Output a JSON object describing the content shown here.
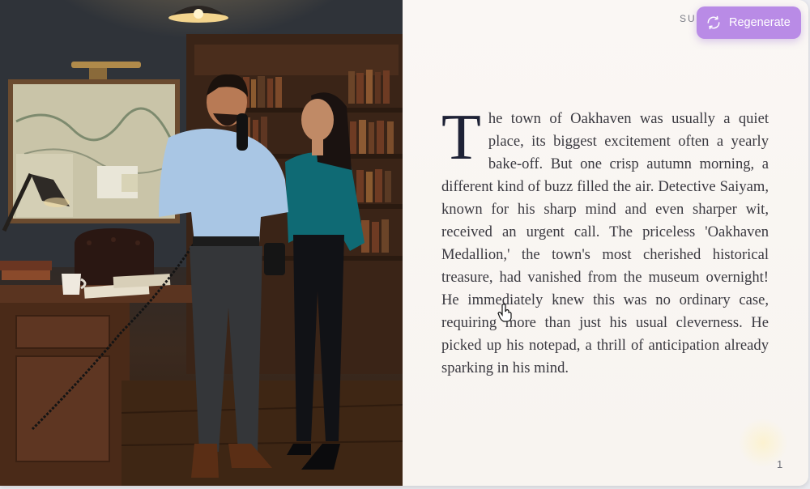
{
  "header": {
    "section_tag": "SUB",
    "regenerate_label": "Regenerate"
  },
  "illustration": {
    "alt": "Detective Saiyam on the phone with a colleague in a study"
  },
  "story": {
    "dropcap": "T",
    "text": "he town of Oakhaven was usually a quiet place, its biggest excitement often a yearly bake-off. But one crisp autumn morning, a different kind of buzz filled the air. Detective Saiyam, known for his sharp mind and even sharper wit, received an urgent call. The priceless 'Oakhaven Medallion,' the town's most cherished historical treasure, had vanished from the museum overnight! He immediately knew this was no ordinary case, requiring more than just his usual cleverness. He picked up his notepad, a thrill of anticipation already sparking in his mind."
  },
  "footer": {
    "page_number": "1"
  },
  "icons": {
    "regenerate": "refresh-icon",
    "cursor": "hand-pointer-icon"
  },
  "colors": {
    "accent": "#b98be6",
    "text": "#3a3940",
    "page": "#faf7f4"
  }
}
